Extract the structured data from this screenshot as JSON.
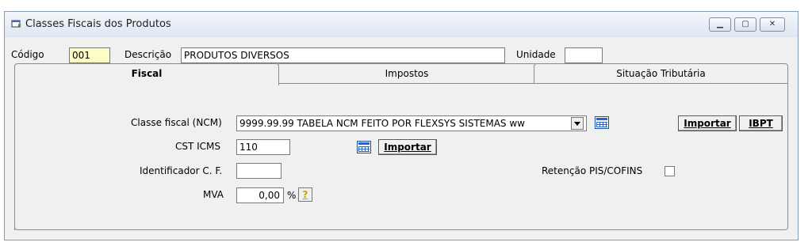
{
  "window": {
    "title": "Classes Fiscais dos Produtos",
    "icon": "window-app-icon"
  },
  "header": {
    "codigo_label": "Código",
    "codigo_value": "001",
    "descricao_label": "Descrição",
    "descricao_value": "PRODUTOS DIVERSOS",
    "unidade_label": "Unidade",
    "unidade_value": ""
  },
  "tabs": [
    {
      "label": "Fiscal",
      "active": true
    },
    {
      "label": "Impostos",
      "active": false
    },
    {
      "label": "Situação Tributária",
      "active": false
    }
  ],
  "fiscal": {
    "classe_label": "Classe fiscal (NCM)",
    "classe_value": "9999.99.99  TABELA NCM FEITO POR FLEXSYS SISTEMAS ww",
    "importar_label": "Importar",
    "ibpt_label": "IBPT",
    "cst_label": "CST ICMS",
    "cst_value": "110",
    "cst_importar_label": "Importar",
    "identificador_label": "Identificador C. F.",
    "identificador_value": "",
    "retencao_label": "Retenção PIS/COFINS",
    "mva_label": "MVA",
    "mva_value": "0,00",
    "mva_unit": "%",
    "help_label": "?"
  }
}
